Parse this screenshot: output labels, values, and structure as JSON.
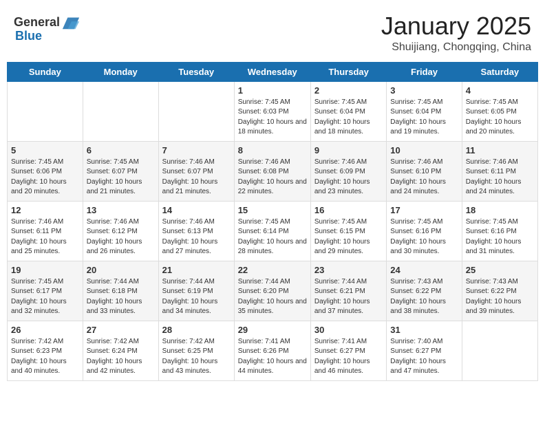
{
  "header": {
    "logo_general": "General",
    "logo_blue": "Blue",
    "month_title": "January 2025",
    "location": "Shuijiang, Chongqing, China"
  },
  "weekdays": [
    "Sunday",
    "Monday",
    "Tuesday",
    "Wednesday",
    "Thursday",
    "Friday",
    "Saturday"
  ],
  "weeks": [
    [
      {
        "day": "",
        "info": ""
      },
      {
        "day": "",
        "info": ""
      },
      {
        "day": "",
        "info": ""
      },
      {
        "day": "1",
        "info": "Sunrise: 7:45 AM\nSunset: 6:03 PM\nDaylight: 10 hours and 18 minutes."
      },
      {
        "day": "2",
        "info": "Sunrise: 7:45 AM\nSunset: 6:04 PM\nDaylight: 10 hours and 18 minutes."
      },
      {
        "day": "3",
        "info": "Sunrise: 7:45 AM\nSunset: 6:04 PM\nDaylight: 10 hours and 19 minutes."
      },
      {
        "day": "4",
        "info": "Sunrise: 7:45 AM\nSunset: 6:05 PM\nDaylight: 10 hours and 20 minutes."
      }
    ],
    [
      {
        "day": "5",
        "info": "Sunrise: 7:45 AM\nSunset: 6:06 PM\nDaylight: 10 hours and 20 minutes."
      },
      {
        "day": "6",
        "info": "Sunrise: 7:45 AM\nSunset: 6:07 PM\nDaylight: 10 hours and 21 minutes."
      },
      {
        "day": "7",
        "info": "Sunrise: 7:46 AM\nSunset: 6:07 PM\nDaylight: 10 hours and 21 minutes."
      },
      {
        "day": "8",
        "info": "Sunrise: 7:46 AM\nSunset: 6:08 PM\nDaylight: 10 hours and 22 minutes."
      },
      {
        "day": "9",
        "info": "Sunrise: 7:46 AM\nSunset: 6:09 PM\nDaylight: 10 hours and 23 minutes."
      },
      {
        "day": "10",
        "info": "Sunrise: 7:46 AM\nSunset: 6:10 PM\nDaylight: 10 hours and 24 minutes."
      },
      {
        "day": "11",
        "info": "Sunrise: 7:46 AM\nSunset: 6:11 PM\nDaylight: 10 hours and 24 minutes."
      }
    ],
    [
      {
        "day": "12",
        "info": "Sunrise: 7:46 AM\nSunset: 6:11 PM\nDaylight: 10 hours and 25 minutes."
      },
      {
        "day": "13",
        "info": "Sunrise: 7:46 AM\nSunset: 6:12 PM\nDaylight: 10 hours and 26 minutes."
      },
      {
        "day": "14",
        "info": "Sunrise: 7:46 AM\nSunset: 6:13 PM\nDaylight: 10 hours and 27 minutes."
      },
      {
        "day": "15",
        "info": "Sunrise: 7:45 AM\nSunset: 6:14 PM\nDaylight: 10 hours and 28 minutes."
      },
      {
        "day": "16",
        "info": "Sunrise: 7:45 AM\nSunset: 6:15 PM\nDaylight: 10 hours and 29 minutes."
      },
      {
        "day": "17",
        "info": "Sunrise: 7:45 AM\nSunset: 6:16 PM\nDaylight: 10 hours and 30 minutes."
      },
      {
        "day": "18",
        "info": "Sunrise: 7:45 AM\nSunset: 6:16 PM\nDaylight: 10 hours and 31 minutes."
      }
    ],
    [
      {
        "day": "19",
        "info": "Sunrise: 7:45 AM\nSunset: 6:17 PM\nDaylight: 10 hours and 32 minutes."
      },
      {
        "day": "20",
        "info": "Sunrise: 7:44 AM\nSunset: 6:18 PM\nDaylight: 10 hours and 33 minutes."
      },
      {
        "day": "21",
        "info": "Sunrise: 7:44 AM\nSunset: 6:19 PM\nDaylight: 10 hours and 34 minutes."
      },
      {
        "day": "22",
        "info": "Sunrise: 7:44 AM\nSunset: 6:20 PM\nDaylight: 10 hours and 35 minutes."
      },
      {
        "day": "23",
        "info": "Sunrise: 7:44 AM\nSunset: 6:21 PM\nDaylight: 10 hours and 37 minutes."
      },
      {
        "day": "24",
        "info": "Sunrise: 7:43 AM\nSunset: 6:22 PM\nDaylight: 10 hours and 38 minutes."
      },
      {
        "day": "25",
        "info": "Sunrise: 7:43 AM\nSunset: 6:22 PM\nDaylight: 10 hours and 39 minutes."
      }
    ],
    [
      {
        "day": "26",
        "info": "Sunrise: 7:42 AM\nSunset: 6:23 PM\nDaylight: 10 hours and 40 minutes."
      },
      {
        "day": "27",
        "info": "Sunrise: 7:42 AM\nSunset: 6:24 PM\nDaylight: 10 hours and 42 minutes."
      },
      {
        "day": "28",
        "info": "Sunrise: 7:42 AM\nSunset: 6:25 PM\nDaylight: 10 hours and 43 minutes."
      },
      {
        "day": "29",
        "info": "Sunrise: 7:41 AM\nSunset: 6:26 PM\nDaylight: 10 hours and 44 minutes."
      },
      {
        "day": "30",
        "info": "Sunrise: 7:41 AM\nSunset: 6:27 PM\nDaylight: 10 hours and 46 minutes."
      },
      {
        "day": "31",
        "info": "Sunrise: 7:40 AM\nSunset: 6:27 PM\nDaylight: 10 hours and 47 minutes."
      },
      {
        "day": "",
        "info": ""
      }
    ]
  ]
}
